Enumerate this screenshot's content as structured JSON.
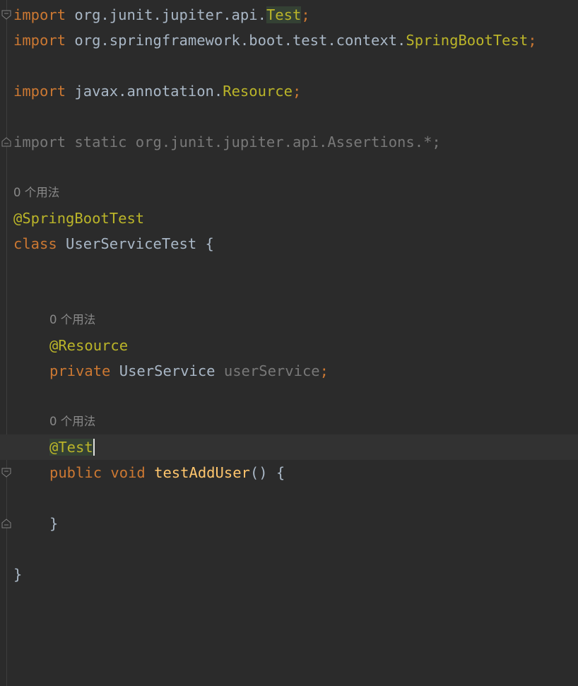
{
  "editor": {
    "lines": [
      {
        "tokens": [
          {
            "t": "import",
            "c": "kw"
          },
          {
            "t": " org.junit.jupiter.api.",
            "c": "pl"
          },
          {
            "t": "Test",
            "c": "cls hl"
          },
          {
            "t": ";",
            "c": "kw"
          }
        ]
      },
      {
        "tokens": [
          {
            "t": "import",
            "c": "kw"
          },
          {
            "t": " org.springframework.boot.test.context.",
            "c": "pl"
          },
          {
            "t": "SpringBootTest",
            "c": "cls"
          },
          {
            "t": ";",
            "c": "kw"
          }
        ]
      },
      {
        "tokens": []
      },
      {
        "tokens": [
          {
            "t": "import",
            "c": "kw"
          },
          {
            "t": " javax.annotation.",
            "c": "pl"
          },
          {
            "t": "Resource",
            "c": "cls"
          },
          {
            "t": ";",
            "c": "kw"
          }
        ]
      },
      {
        "tokens": []
      },
      {
        "tokens": [
          {
            "t": "import static org.junit.jupiter.api.Assertions.*;",
            "c": "dim"
          }
        ]
      },
      {
        "tokens": []
      },
      {
        "hint": "0 个用法"
      },
      {
        "tokens": [
          {
            "t": "@SpringBootTest",
            "c": "ann"
          }
        ]
      },
      {
        "tokens": [
          {
            "t": "class",
            "c": "kw"
          },
          {
            "t": " UserServiceTest {",
            "c": "pl"
          }
        ]
      },
      {
        "tokens": []
      },
      {
        "tokens": []
      },
      {
        "hint": "0 个用法",
        "indent": true
      },
      {
        "tokens": [
          {
            "t": "@Resource",
            "c": "ann"
          }
        ],
        "indent": true
      },
      {
        "tokens": [
          {
            "t": "private",
            "c": "kw"
          },
          {
            "t": " UserService ",
            "c": "pl"
          },
          {
            "t": "userService",
            "c": "dim"
          },
          {
            "t": ";",
            "c": "kw"
          }
        ],
        "indent": true
      },
      {
        "tokens": []
      },
      {
        "hint": "0 个用法",
        "indent": true
      },
      {
        "tokens": [
          {
            "t": "@Test",
            "c": "ann hl"
          }
        ],
        "indent": true,
        "current": true,
        "caret": true
      },
      {
        "tokens": [
          {
            "t": "public",
            "c": "kw"
          },
          {
            "t": " ",
            "c": "pl"
          },
          {
            "t": "void",
            "c": "kw"
          },
          {
            "t": " ",
            "c": "pl"
          },
          {
            "t": "testAddUser",
            "c": "fn"
          },
          {
            "t": "() {",
            "c": "pl"
          }
        ],
        "indent": true
      },
      {
        "tokens": []
      },
      {
        "tokens": [
          {
            "t": "}",
            "c": "pl"
          }
        ],
        "indent": true
      },
      {
        "tokens": []
      },
      {
        "tokens": [
          {
            "t": "}",
            "c": "pl"
          }
        ]
      }
    ],
    "fold_markers": [
      {
        "line": 0,
        "type": "fold-start-icon"
      },
      {
        "line": 5,
        "type": "fold-end-icon"
      },
      {
        "line": 18,
        "type": "fold-start-icon"
      },
      {
        "line": 20,
        "type": "fold-end-icon"
      }
    ]
  },
  "colors": {
    "background": "#2b2b2b",
    "current_line": "#323232",
    "keyword": "#cc7832",
    "plain": "#a9b7c6",
    "annotation": "#bbb529",
    "function": "#ffc66d",
    "dimmed": "#787878",
    "hint": "#8a8a8a",
    "highlight": "#344134"
  }
}
